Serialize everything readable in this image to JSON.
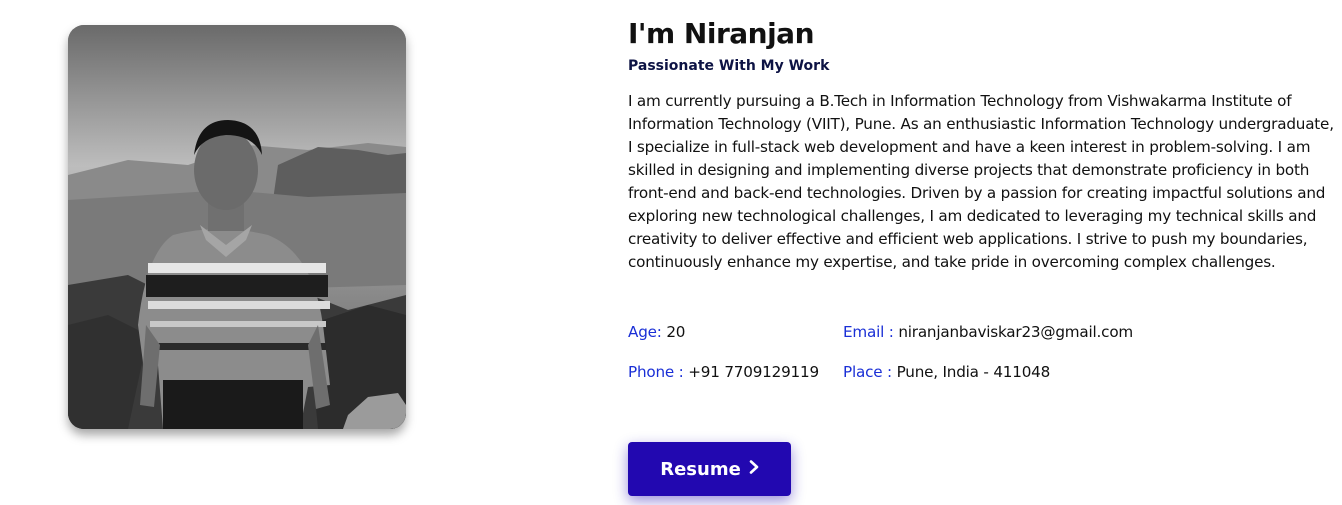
{
  "about": {
    "photo_alt": "Portrait of Niranjan",
    "name": "I'm Niranjan",
    "tagline": "Passionate With My Work",
    "bio": "I am currently pursuing a B.Tech in Information Technology from Vishwakarma Institute of Information Technology (VIIT), Pune. As an enthusiastic Information Technology undergraduate, I specialize in full-stack web development and have a keen interest in problem-solving. I am skilled in designing and implementing diverse projects that demonstrate proficiency in both front-end and back-end technologies. Driven by a passion for creating impactful solutions and exploring new technological challenges, I am dedicated to leveraging my technical skills and creativity to deliver effective and efficient web applications. I strive to push my boundaries, continuously enhance my expertise, and take pride in overcoming complex challenges.",
    "info": {
      "age_label": "Age:",
      "age_value": "20",
      "email_label": "Email :",
      "email_value": "niranjanbaviskar23@gmail.com",
      "phone_label": "Phone :",
      "phone_value": "+91 7709129119",
      "place_label": "Place :",
      "place_value": "Pune, India - 411048"
    },
    "resume_button": {
      "label": "Resume",
      "icon": "chevron-right-icon"
    }
  },
  "colors": {
    "accent_button": "#2208b0",
    "label_blue": "#1a2fd6",
    "tagline_navy": "#0d1344"
  }
}
